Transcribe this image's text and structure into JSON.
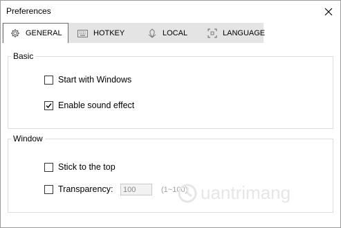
{
  "window": {
    "title": "Preferences"
  },
  "tabs": [
    {
      "label": "GENERAL",
      "icon": "gear-icon",
      "active": true
    },
    {
      "label": "HOTKEY",
      "icon": "keyboard-icon",
      "active": false
    },
    {
      "label": "LOCAL",
      "icon": "globe-icon",
      "active": false
    },
    {
      "label": "LANGUAGE",
      "icon": "language-icon",
      "active": false
    }
  ],
  "basic": {
    "title": "Basic",
    "start_with_windows": {
      "label": "Start with Windows",
      "checked": false
    },
    "enable_sound": {
      "label": "Enable sound effect",
      "checked": true
    }
  },
  "window_group": {
    "title": "Window",
    "stick_top": {
      "label": "Stick to the top",
      "checked": false
    },
    "transparency": {
      "label": "Transparency:",
      "checked": false,
      "value": "100",
      "range": "(1~100)"
    }
  },
  "watermark": {
    "text": "uantrimang"
  },
  "colors": {
    "frame": "#f0f0f0",
    "tab_bg": "#e4e4e4",
    "border": "#dcdcdc"
  }
}
